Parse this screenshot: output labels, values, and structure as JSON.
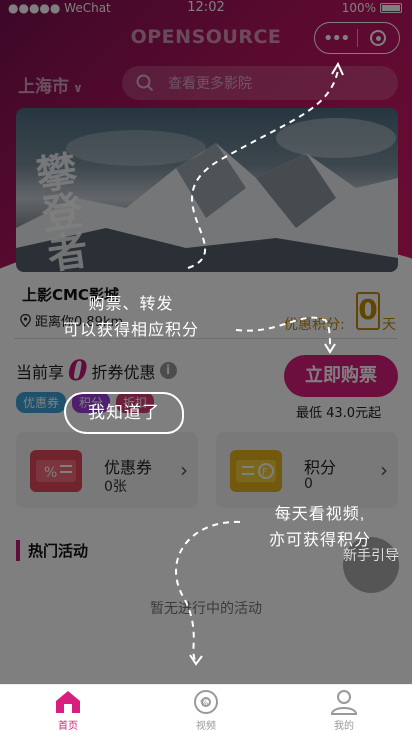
{
  "status_bar": {
    "carrier": "●●●●● WeChat",
    "time": "12:02",
    "battery": "100%"
  },
  "header": {
    "title": "OPENSOURCE",
    "city": "上海市",
    "search_placeholder": "查看更多影院"
  },
  "banner": {
    "calligraphy": "攀登者"
  },
  "cinema": {
    "name": "上影CMC影城",
    "distance": "距离你0.89km",
    "points_label": "优惠积分:",
    "points_value": "0",
    "points_unit": "天",
    "discount_prefix": "当前享",
    "discount_value": "0",
    "discount_suffix": "折券优惠",
    "tags": [
      "优惠券",
      "积分",
      "折扣"
    ],
    "buy_button": "立即购票",
    "min_price": "最低 43.0元起"
  },
  "cards": [
    {
      "name": "优惠券",
      "value": "0张"
    },
    {
      "name": "积分",
      "value": "0"
    }
  ],
  "activities": {
    "title": "热门活动",
    "empty": "暂无进行中的活动"
  },
  "guide_bubble": "新手引导",
  "overlay": {
    "hint1_line1": "购票、转发",
    "hint1_line2": "可以获得相应积分",
    "ok_button": "我知道了",
    "hint2_line1": "每天看视频,",
    "hint2_line2": "亦可获得积分"
  },
  "tabbar": [
    {
      "label": "首页",
      "icon": "home-icon"
    },
    {
      "label": "视频",
      "icon": "video-icon"
    },
    {
      "label": "我的",
      "icon": "profile-icon"
    }
  ],
  "colors": {
    "brand": "#d81e7f",
    "gold": "#c58a00",
    "header_start": "#7a1150"
  }
}
